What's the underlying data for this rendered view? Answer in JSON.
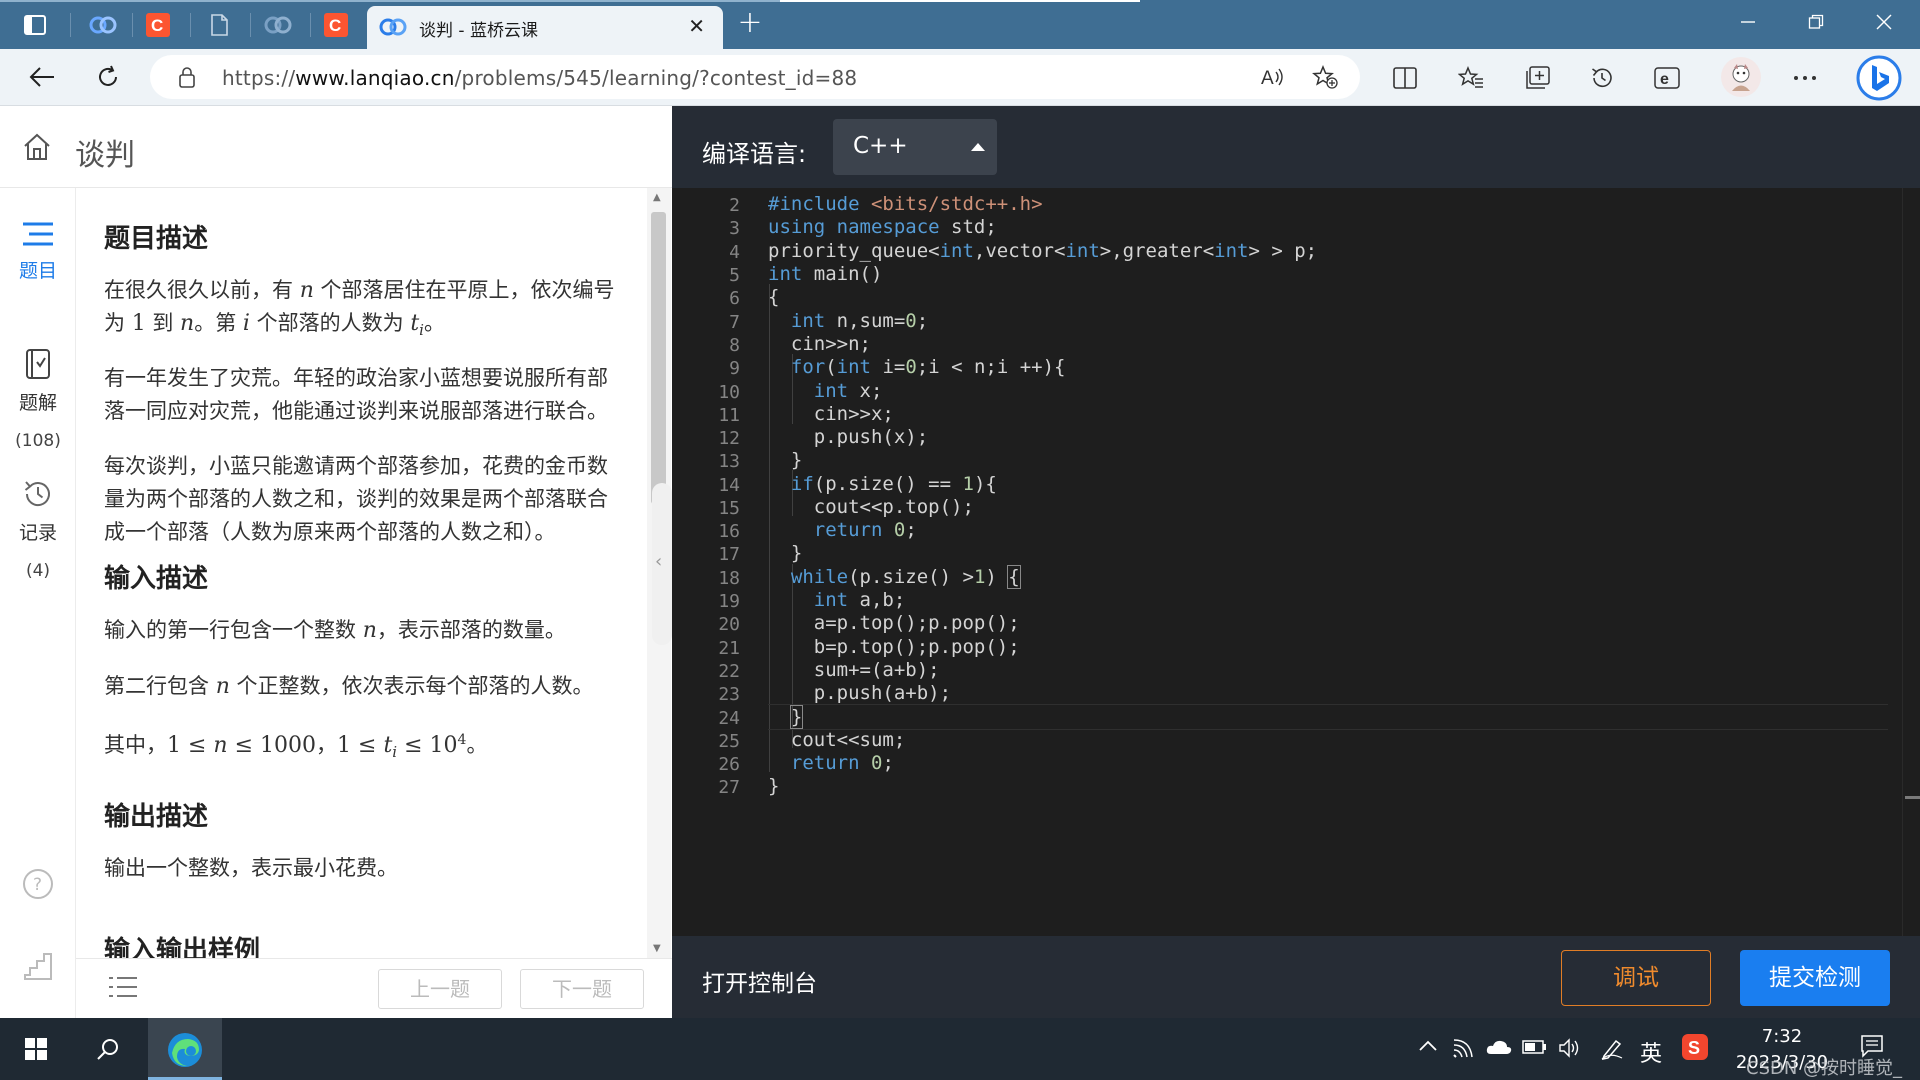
{
  "browser": {
    "active_tab_title": "谈判 - 蓝桥云课",
    "url_prefix": "https://",
    "url_host": "www.lanqiao.cn",
    "url_path": "/problems/545/learning/?contest_id=88",
    "new_tab_label": "+",
    "close_tab_label": "✕"
  },
  "left_panel": {
    "page_title": "谈判",
    "rail": {
      "problem_label": "题目",
      "solutions_label": "题解",
      "solutions_count": "(108)",
      "records_label": "记录",
      "records_count": "(4)"
    },
    "sections": {
      "desc_heading": "题目描述",
      "desc_p1_a": "在很久很久以前，有 ",
      "desc_p1_var_n": "n",
      "desc_p1_b": " 个部落居住在平原上，依次编号为 ",
      "desc_p1_one": "1",
      "desc_p1_c": " 到 ",
      "desc_p1_var_n2": "n",
      "desc_p1_d": "。第 ",
      "desc_p1_var_i": "i",
      "desc_p1_e": " 个部落的人数为 ",
      "desc_p1_var_t": "t",
      "desc_p1_sub_i": "i",
      "desc_p1_f": "。",
      "desc_p2": "有一年发生了灾荒。年轻的政治家小蓝想要说服所有部落一同应对灾荒，他能通过谈判来说服部落进行联合。",
      "desc_p3": "每次谈判，小蓝只能邀请两个部落参加，花费的金币数量为两个部落的人数之和，谈判的效果是两个部落联合成一个部落（人数为原来两个部落的人数之和）。",
      "input_heading": "输入描述",
      "input_p1_a": "输入的第一行包含一个整数 ",
      "input_p1_var": "n",
      "input_p1_b": "，表示部落的数量。",
      "input_p2_a": "第二行包含 ",
      "input_p2_var": "n",
      "input_p2_b": " 个正整数，依次表示每个部落的人数。",
      "input_p3_a": "其中，",
      "input_p3_math1": "1 ≤ ",
      "input_p3_var1": "n",
      "input_p3_math2": " ≤ 1000",
      "input_p3_sep": "，",
      "input_p3_math3": "1 ≤ ",
      "input_p3_var2": "t",
      "input_p3_sub": "i",
      "input_p3_math4": " ≤ 10",
      "input_p3_sup": "4",
      "input_p3_end": "。",
      "output_heading": "输出描述",
      "output_p1": "输出一个整数，表示最小花费。",
      "next_heading_cut": "输入输出样例"
    },
    "prev_button": "上一题",
    "next_button": "下一题"
  },
  "editor": {
    "language_label": "编译语言:",
    "language_value": "C++",
    "console_label": "打开控制台",
    "debug_button": "调试",
    "submit_button": "提交检测",
    "line_numbers": [
      "2",
      "3",
      "4",
      "5",
      "6",
      "7",
      "8",
      "9",
      "10",
      "11",
      "12",
      "13",
      "14",
      "15",
      "16",
      "17",
      "18",
      "19",
      "20",
      "21",
      "22",
      "23",
      "24",
      "25",
      "26",
      "27"
    ]
  },
  "taskbar": {
    "ime_label": "英",
    "time": "7:32",
    "date": "2023/3/30",
    "watermark": "CSDN @按时睡觉_"
  }
}
